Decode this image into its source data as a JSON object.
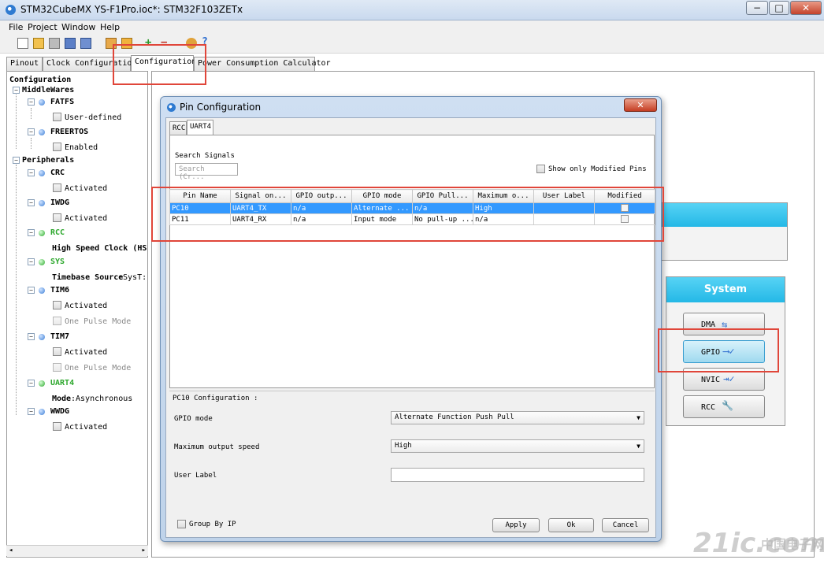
{
  "window": {
    "title": "STM32CubeMX YS-F1Pro.ioc*: STM32F103ZETx",
    "controls": [
      "−",
      "□",
      "✕"
    ]
  },
  "menu": [
    "File",
    "Project",
    "Window",
    "Help"
  ],
  "toolbar_icons": [
    "new-project-icon",
    "load-project-icon",
    "save-icon",
    "save-as-icon",
    "close-project-icon",
    "generate-report-icon",
    "generate-code-icon",
    "zoom-in-icon",
    "zoom-out-icon",
    "key-icon",
    "help-icon"
  ],
  "main_tabs": [
    "Pinout",
    "Clock Configuration",
    "Configuration",
    "Power Consumption Calculator"
  ],
  "tree": {
    "root": "Configuration",
    "middlewares_label": "MiddleWares",
    "fatfs": {
      "label": "FATFS",
      "option": "User-defined"
    },
    "freertos": {
      "label": "FREERTOS",
      "option": "Enabled"
    },
    "peripherals_label": "Peripherals",
    "crc": {
      "label": "CRC",
      "option": "Activated"
    },
    "iwdg": {
      "label": "IWDG",
      "option": "Activated"
    },
    "rcc": {
      "label": "RCC",
      "setting": "High Speed Clock (HS"
    },
    "sys": {
      "label": "SYS",
      "setting_key": "Timebase Source",
      "setting_value": ":SysT:"
    },
    "tim6": {
      "label": "TIM6",
      "option1": "Activated",
      "option2": "One Pulse Mode"
    },
    "tim7": {
      "label": "TIM7",
      "option1": "Activated",
      "option2": "One Pulse Mode"
    },
    "uart4": {
      "label": "UART4",
      "setting_key": "Mode",
      "setting_value": ":Asynchronous"
    },
    "wwdg": {
      "label": "WWDG",
      "option": "Activated"
    }
  },
  "system_panel": {
    "title": "System",
    "buttons": [
      "DMA",
      "GPIO",
      "NVIC",
      "RCC"
    ]
  },
  "dialog": {
    "title": "Pin Configuration",
    "close": "✕",
    "tabs": [
      "RCC",
      "UART4"
    ],
    "search_label": "Search Signals",
    "search_placeholder": "Search (Cr...",
    "show_modified_label": "Show only Modified Pins",
    "table": {
      "columns": [
        "Pin Name",
        "Signal on...",
        "GPIO outp...",
        "GPIO mode",
        "GPIO Pull...",
        "Maximum o...",
        "User Label",
        "Modified"
      ],
      "rows": [
        [
          "PC10",
          "UART4_TX",
          "n/a",
          "Alternate ...",
          "n/a",
          "High",
          "",
          ""
        ],
        [
          "PC11",
          "UART4_RX",
          "n/a",
          "Input mode",
          "No pull-up ...",
          "n/a",
          "",
          ""
        ]
      ]
    },
    "config_title": "PC10 Configuration :",
    "fields": {
      "gpio_mode_label": "GPIO mode",
      "gpio_mode_value": "Alternate Function Push Pull",
      "max_speed_label": "Maximum output speed",
      "max_speed_value": "High",
      "user_label_label": "User Label",
      "user_label_value": ""
    },
    "group_by_ip": "Group By IP",
    "buttons": {
      "apply": "Apply",
      "ok": "Ok",
      "cancel": "Cancel"
    }
  },
  "watermark": "21ic.com",
  "watermark_cn": "中国电子网",
  "accent_colors": {
    "highlight": "#e0463a",
    "cyan": "#24b8e6",
    "green": "#2ea82e",
    "selection": "#3399ff"
  }
}
